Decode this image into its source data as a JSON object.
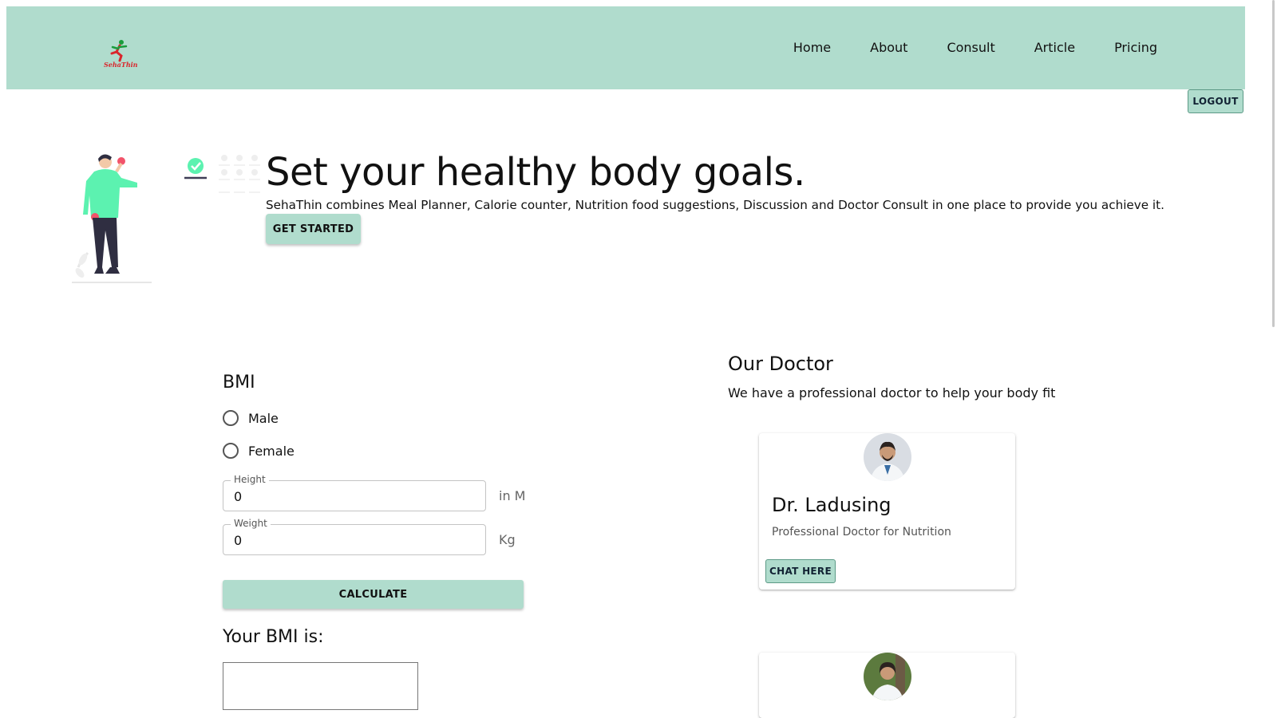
{
  "brand": {
    "logo_text": "SehaThin"
  },
  "nav": {
    "items": [
      "Home",
      "About",
      "Consult",
      "Article",
      "Pricing"
    ],
    "logout_label": "LOGOUT"
  },
  "hero": {
    "title": "Set your healthy body goals.",
    "subtitle": "SehaThin combines Meal Planner, Calorie counter, Nutrition food suggestions, Discussion and Doctor Consult in one place to provide you achieve it.",
    "cta_label": "GET STARTED"
  },
  "bmi": {
    "title": "BMI",
    "options": [
      "Male",
      "Female"
    ],
    "height": {
      "label": "Height",
      "value": "0",
      "unit": "in M"
    },
    "weight": {
      "label": "Weight",
      "value": "0",
      "unit": "Kg"
    },
    "calculate_label": "CALCULATE",
    "result_title": "Your BMI is:"
  },
  "doctors": {
    "title": "Our Doctor",
    "subtitle": "We have a professional doctor to help your body fit",
    "list": [
      {
        "name": "Dr. Ladusing",
        "role": "Professional Doctor for Nutrition",
        "button": "CHAT HERE"
      }
    ]
  },
  "colors": {
    "accent": "#b0dccd",
    "accent_border": "#5c9a86",
    "illustration_shirt": "#5cf2b0",
    "illustration_apple": "#f2536a"
  }
}
